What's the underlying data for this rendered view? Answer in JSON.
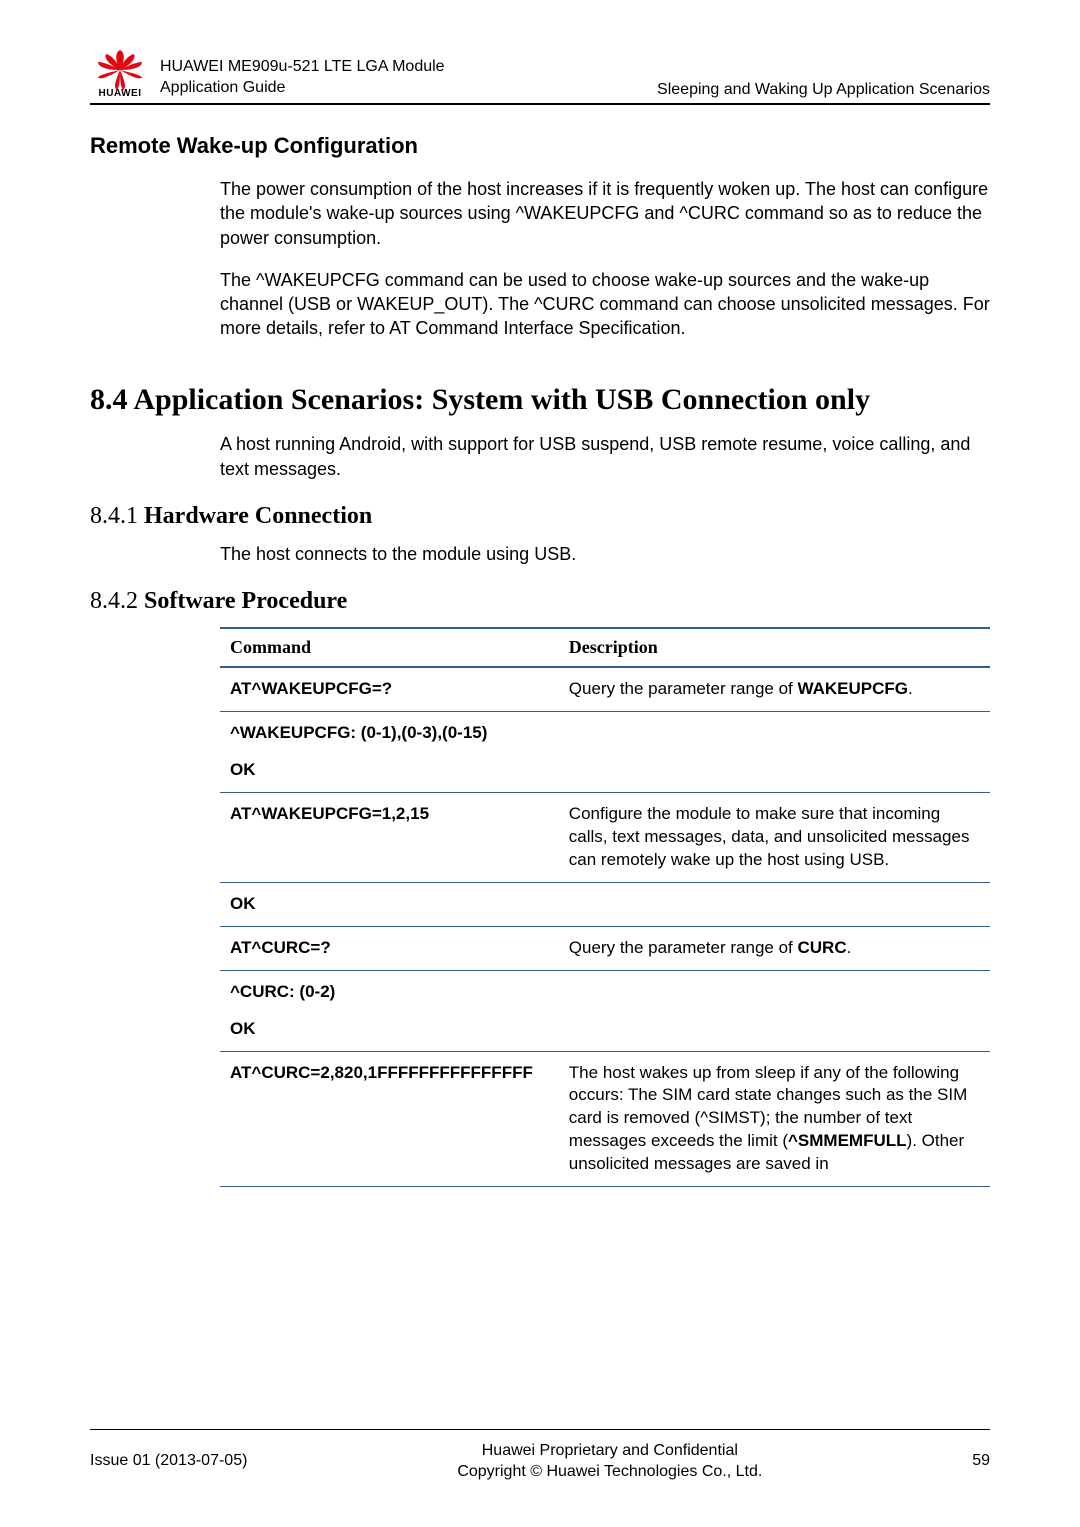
{
  "header": {
    "brand_text": "HUAWEI",
    "doc_title_line1": "HUAWEI ME909u-521 LTE LGA Module",
    "doc_title_line2": "Application Guide",
    "chapter_title": "Sleeping and Waking Up Application Scenarios"
  },
  "section_remote": {
    "heading": "Remote Wake-up Configuration",
    "p1": "The power consumption of the host increases if it is frequently woken up. The host can configure the module's wake-up sources using ^WAKEUPCFG and ^CURC command so as to reduce the power consumption.",
    "p2": "The ^WAKEUPCFG command can be used to choose wake-up sources and the wake-up channel (USB or WAKEUP_OUT). The ^CURC command can choose unsolicited messages. For more details, refer to AT Command Interface Specification."
  },
  "section_84": {
    "heading": "8.4 Application Scenarios: System with USB Connection only",
    "p1": "A host running Android, with support for USB suspend, USB remote resume, voice calling, and text messages."
  },
  "section_841": {
    "num": "8.4.1 ",
    "title": "Hardware Connection",
    "p1": "The host connects to the module using USB."
  },
  "section_842": {
    "num": "8.4.2 ",
    "title": "Software Procedure"
  },
  "table": {
    "head_cmd": "Command",
    "head_desc": "Description",
    "rows": [
      {
        "cmd_bold": "AT^WAKEUPCFG=?",
        "desc_pre": "Query the parameter range of ",
        "desc_bold": "WAKEUPCFG",
        "desc_post": "."
      },
      {
        "cmd_line1": "^WAKEUPCFG: (0-1),(0-3),(0-15)",
        "cmd_line2": "OK",
        "desc_pre": "",
        "desc_bold": "",
        "desc_post": ""
      },
      {
        "cmd_bold": "AT^WAKEUPCFG=1,2,15",
        "desc_pre": "Configure the module to make sure that incoming calls, text messages, data, and unsolicited messages can remotely wake up the host using USB.",
        "desc_bold": "",
        "desc_post": ""
      },
      {
        "cmd_bold": "OK",
        "desc_pre": "",
        "desc_bold": "",
        "desc_post": ""
      },
      {
        "cmd_bold": "AT^CURC=?",
        "desc_pre": "Query the parameter range of ",
        "desc_bold": "CURC",
        "desc_post": "."
      },
      {
        "cmd_line1": "^CURC: (0-2)",
        "cmd_line2": "OK",
        "desc_pre": "",
        "desc_bold": "",
        "desc_post": ""
      },
      {
        "cmd_bold": "AT^CURC=2,820,1FFFFFFFFFFFFFFF",
        "desc_pre": "The host wakes up from sleep if any of the following occurs: The SIM card state changes such as the SIM card is removed (^SIMST); the number of text messages exceeds the limit (",
        "desc_bold": "^SMMEMFULL",
        "desc_post": "). Other unsolicited messages are saved in"
      }
    ]
  },
  "footer": {
    "left": "Issue 01 (2013-07-05)",
    "center_l1": "Huawei Proprietary and Confidential",
    "center_l2": "Copyright © Huawei Technologies Co., Ltd.",
    "right": "59"
  }
}
